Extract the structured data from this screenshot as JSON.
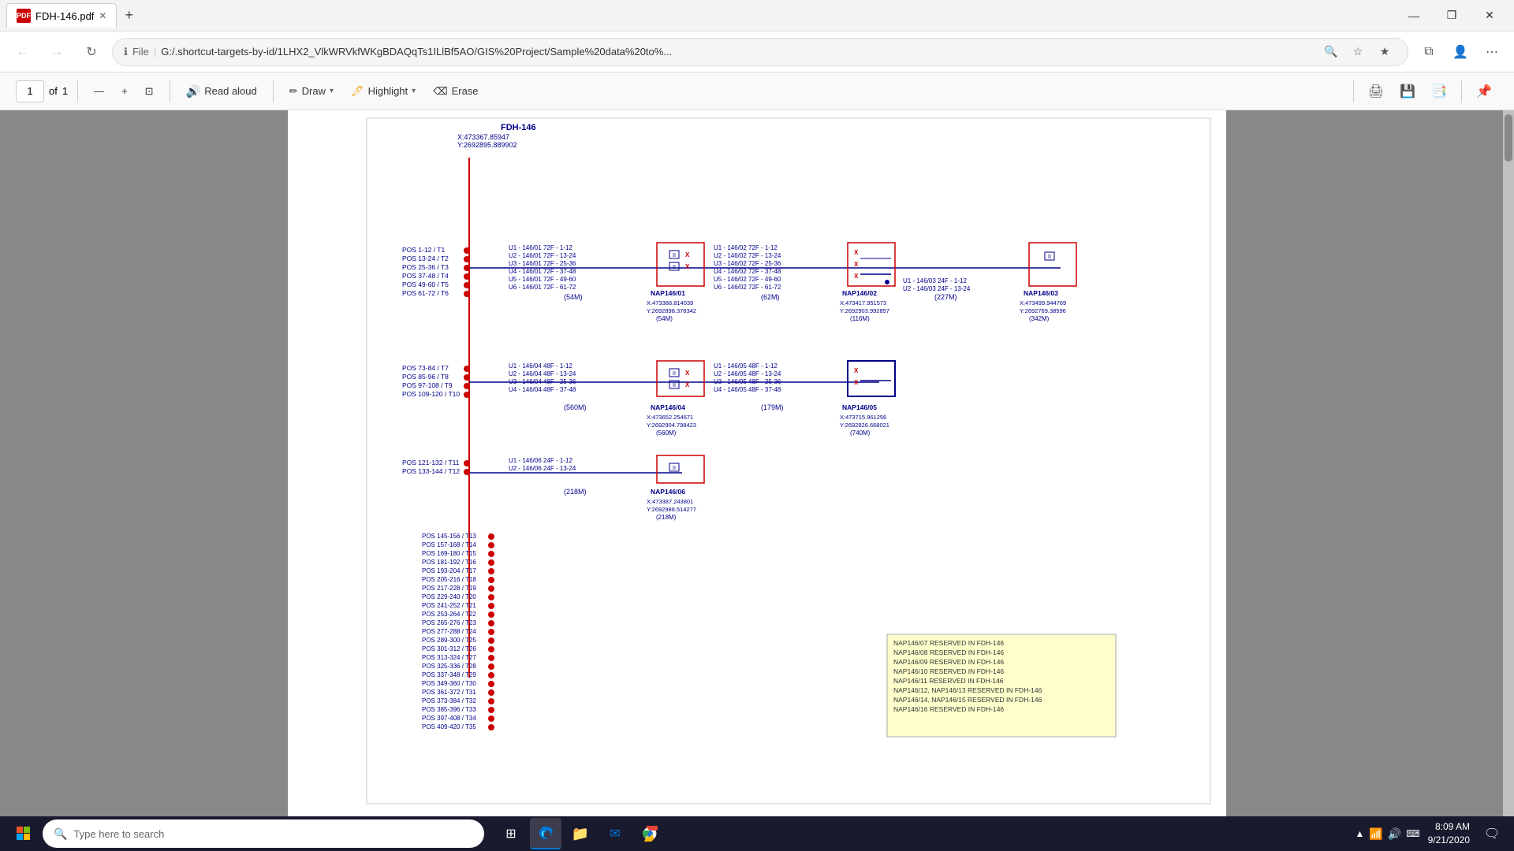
{
  "window": {
    "title": "FDH-146.pdf",
    "tab_icon": "PDF",
    "close_btn": "✕",
    "new_tab_btn": "+"
  },
  "window_controls": {
    "minimize": "—",
    "maximize": "❐",
    "close": "✕"
  },
  "address_bar": {
    "file_label": "File",
    "url": "G:/.shortcut-targets-by-id/1LHX2_VlkWRVkfWKgBDAQqTs1ILlBf5AO/GIS%20Project/Sample%20data%20to%...",
    "search_icon": "🔍",
    "star_icon": "☆",
    "fav_icon": "★",
    "profile_icon": "👤",
    "more_icon": "⋯"
  },
  "pdf_toolbar": {
    "page_current": "1",
    "page_total": "1",
    "zoom_out": "—",
    "zoom_in": "+",
    "fit_page": "⊡",
    "read_aloud": "Read aloud",
    "draw": "Draw",
    "highlight": "Highlight",
    "erase": "Erase",
    "print": "🖨",
    "save": "💾",
    "save_as": "📑",
    "pin": "📌"
  },
  "diagram": {
    "title": "FDH-146",
    "coords_title": "X:473367.85947\nY:2692895.889902",
    "nap_nodes": [
      {
        "id": "NAP146/01",
        "x": "X:473386.814039",
        "y": "Y:2692898.378342",
        "capacity": "(54M)"
      },
      {
        "id": "NAP146/02",
        "x": "X:473417.951573",
        "y": "Y:2692903.992857",
        "capacity": "(116M)"
      },
      {
        "id": "NAP146/03",
        "x": "X:473499.944769",
        "y": "Y:2692769.38596",
        "capacity": "(342M)"
      },
      {
        "id": "NAP146/04",
        "x": "X:473652.254671",
        "y": "Y:2692904.798423",
        "capacity": "(560M)"
      },
      {
        "id": "NAP146/05",
        "x": "X:473715.961256",
        "y": "Y:2692826.668021",
        "capacity": "(740M)"
      },
      {
        "id": "NAP146/06",
        "x": "X:473387.243801",
        "y": "Y:2692988.514277",
        "capacity": "(218M)"
      }
    ],
    "reserved_notes": [
      "NAP146/07  RESERVED IN FDH-146",
      "NAP146/08  RESERVED IN FDH-146",
      "NAP146/09  RESERVED IN FDH-146",
      "NAP146/10  RESERVED IN FDH-146",
      "NAP146/11  RESERVED IN FDH-146",
      "NAP146/12, NAP146/13  RESERVED IN FDH-146",
      "NAP146/14, NAP146/15  RESERVED IN FDH-146",
      "NAP146/16  RESERVED IN FDH-146"
    ]
  },
  "taskbar": {
    "search_placeholder": "Type here to search",
    "time": "8:09 AM",
    "date": "9/21/2020"
  }
}
